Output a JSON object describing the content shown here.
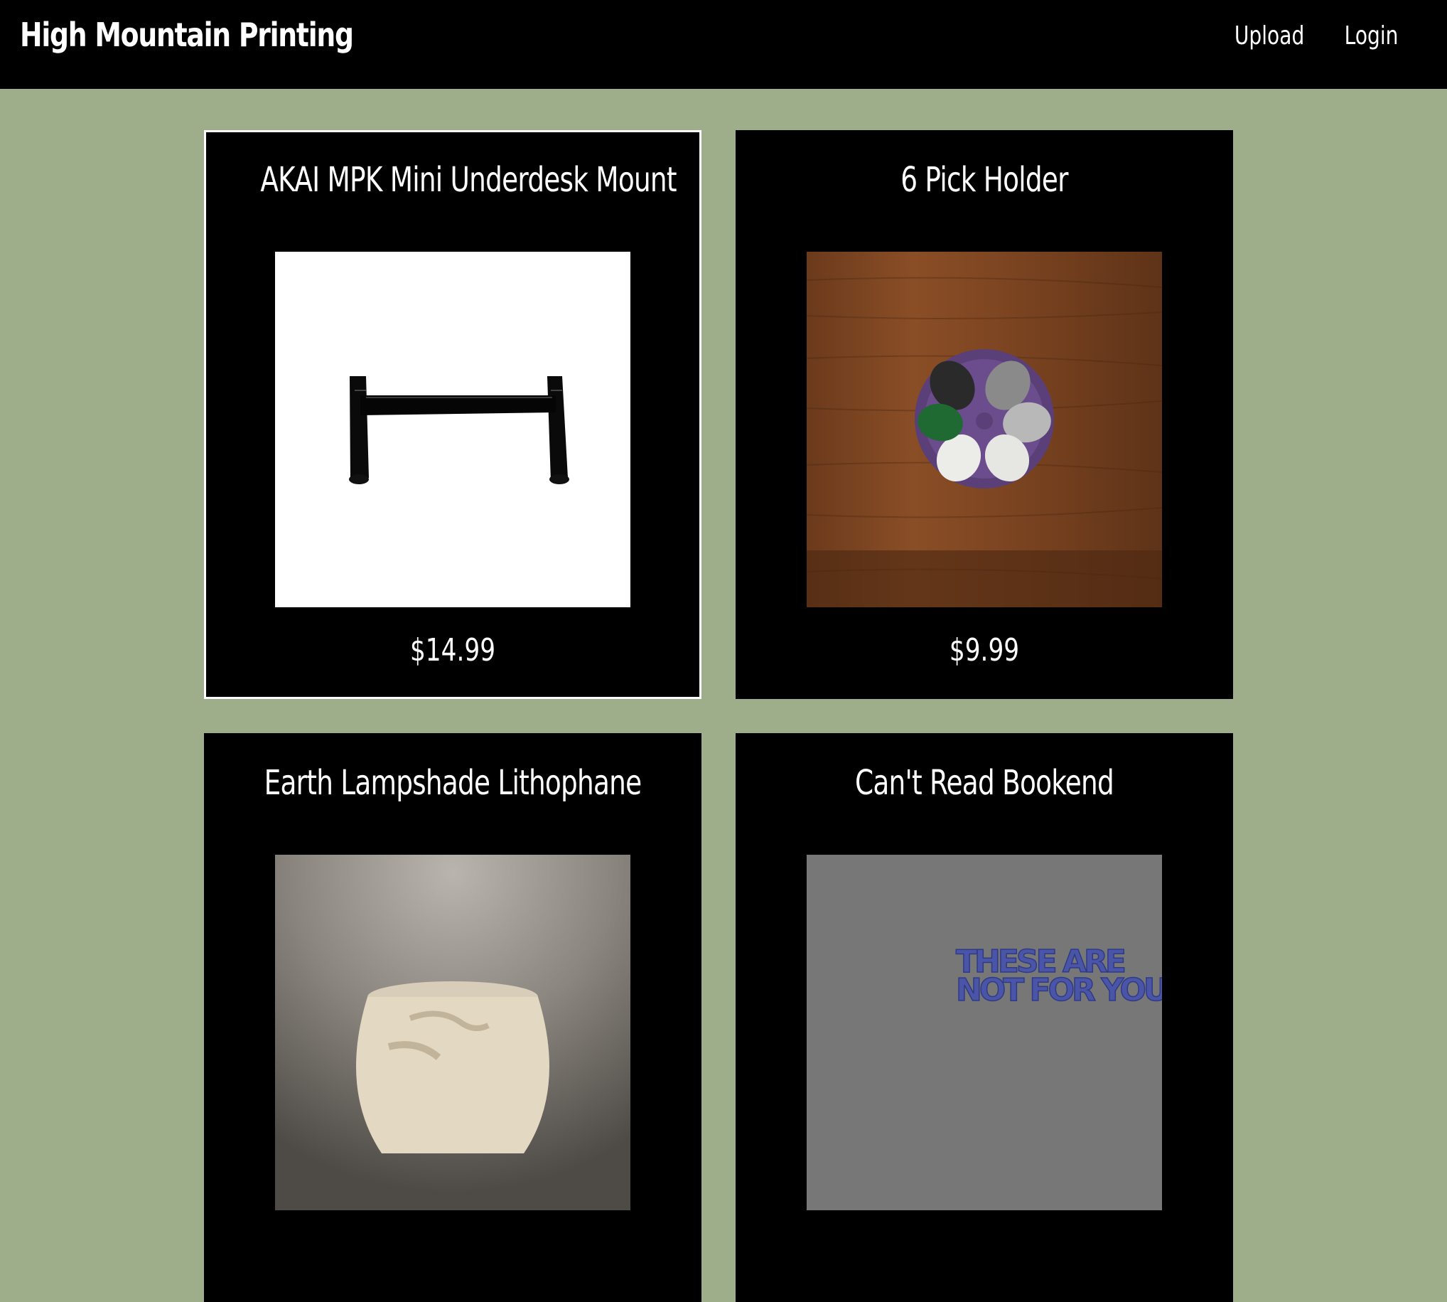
{
  "header": {
    "brand": "High Mountain Printing",
    "nav": [
      {
        "label": "Upload"
      },
      {
        "label": "Login"
      }
    ]
  },
  "products": [
    {
      "title": "AKAI MPK Mini Underdesk Mount",
      "price": "$14.99",
      "image": "underdesk-mount-photo"
    },
    {
      "title": "6 Pick Holder",
      "price": "$9.99",
      "image": "pick-holder-photo"
    },
    {
      "title": "Earth Lampshade Lithophane",
      "price": "",
      "image": "lampshade-photo"
    },
    {
      "title": "Can't Read Bookend",
      "price": "",
      "image": "bookend-render",
      "image_text": [
        "THESE ARE",
        "NOT FOR YOU"
      ]
    }
  ],
  "colors": {
    "page_background": "#9eae8a",
    "card_background": "#000000",
    "header_background": "#000000",
    "text": "#ffffff"
  }
}
